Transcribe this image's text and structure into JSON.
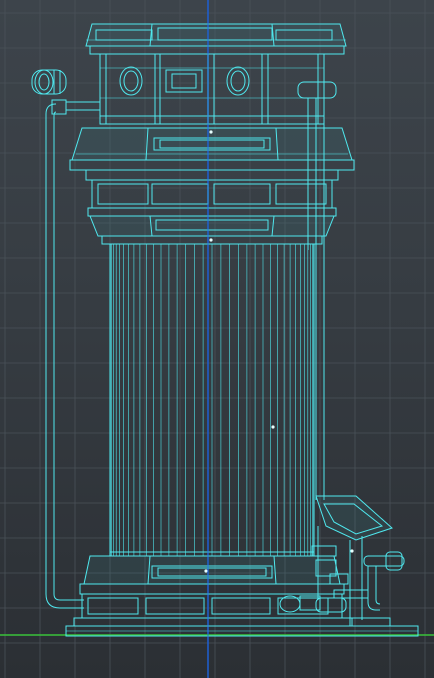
{
  "viewport": {
    "view": "orthographic-front",
    "mode": "wireframe",
    "colors": {
      "background_top": "#3d444b",
      "background_bottom": "#2b2f34",
      "grid": "#4a5259",
      "axis_vertical": "#1f5fd0",
      "axis_horizontal": "#39c23a",
      "wireframe": "#4fe8ee"
    }
  },
  "model": {
    "type": "tower-structure",
    "grooves": 36,
    "selected_vertex": "true"
  }
}
